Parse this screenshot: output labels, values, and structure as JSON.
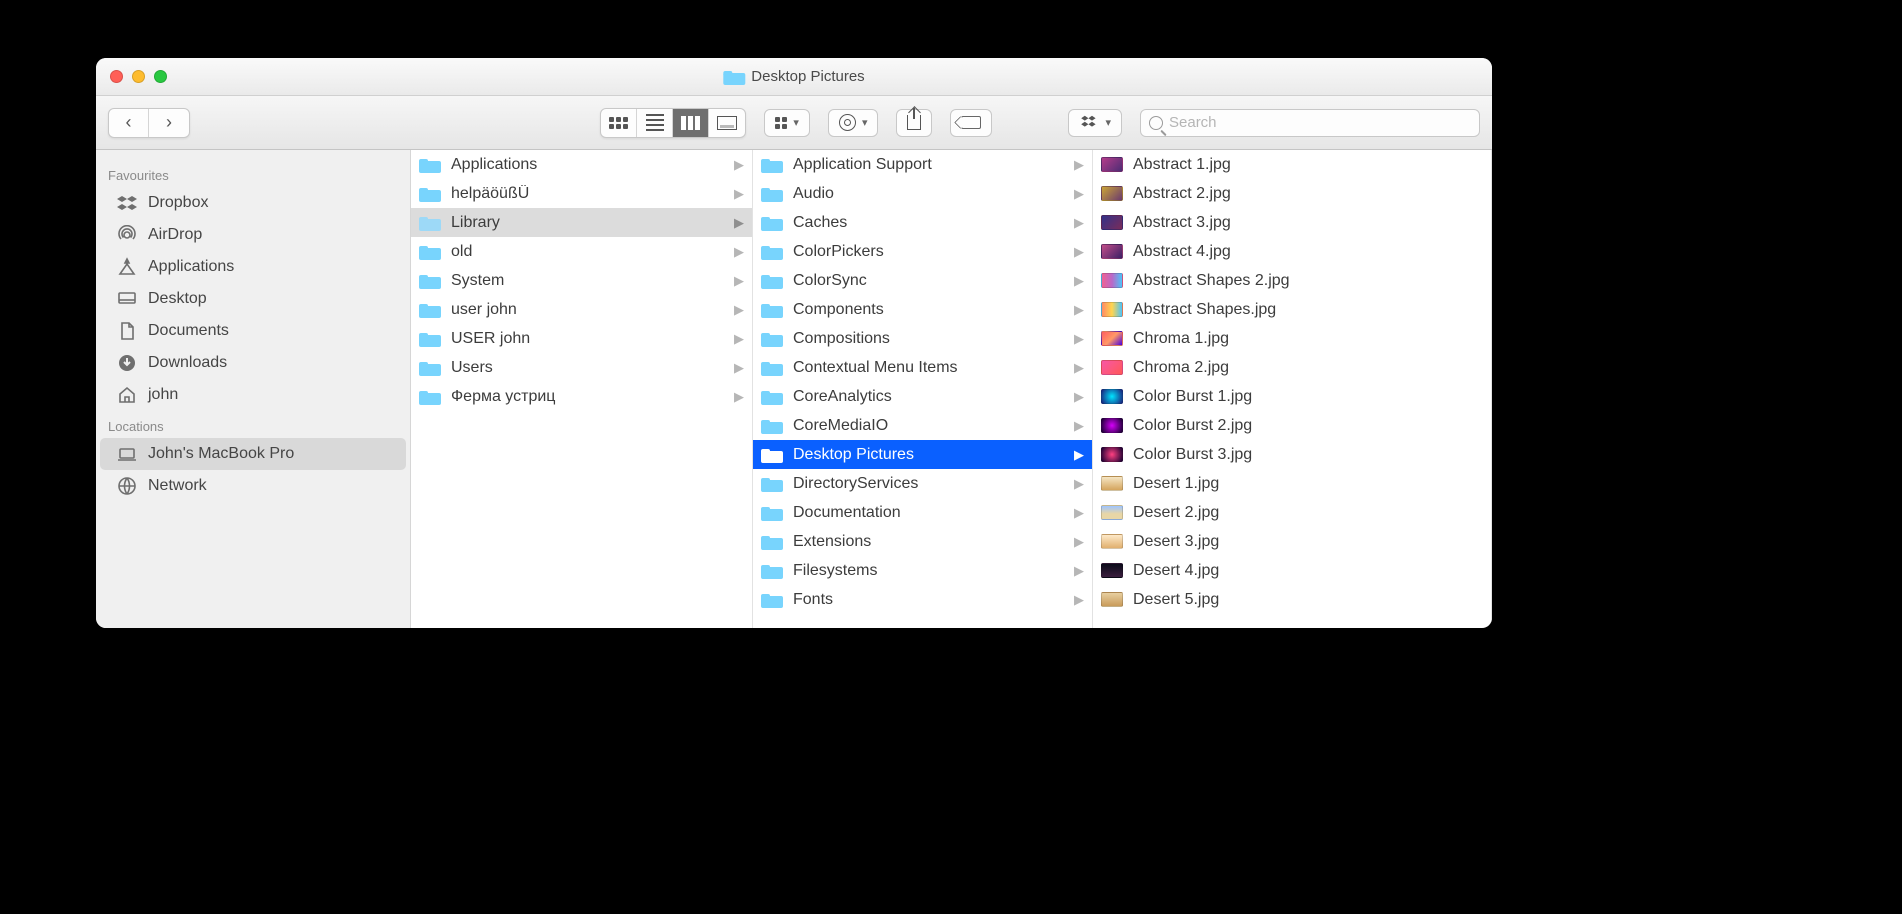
{
  "window": {
    "title": "Desktop Pictures"
  },
  "search": {
    "placeholder": "Search"
  },
  "sidebar": {
    "sections": [
      {
        "heading": "Favourites",
        "items": [
          {
            "icon": "dropbox",
            "label": "Dropbox"
          },
          {
            "icon": "airdrop",
            "label": "AirDrop"
          },
          {
            "icon": "apps",
            "label": "Applications"
          },
          {
            "icon": "desktop",
            "label": "Desktop"
          },
          {
            "icon": "documents",
            "label": "Documents"
          },
          {
            "icon": "downloads",
            "label": "Downloads"
          },
          {
            "icon": "home",
            "label": "john"
          }
        ]
      },
      {
        "heading": "Locations",
        "items": [
          {
            "icon": "laptop",
            "label": "John's MacBook Pro",
            "selected": true
          },
          {
            "icon": "network",
            "label": "Network"
          }
        ]
      }
    ]
  },
  "columns": [
    {
      "items": [
        {
          "label": "Applications",
          "type": "folder",
          "hasChildren": true
        },
        {
          "label": "helpäöüßÜ",
          "type": "folder",
          "hasChildren": true
        },
        {
          "label": "Library",
          "type": "folder",
          "hasChildren": true,
          "state": "path"
        },
        {
          "label": "old",
          "type": "folder",
          "hasChildren": true
        },
        {
          "label": "System",
          "type": "folder",
          "hasChildren": true
        },
        {
          "label": "user john",
          "type": "folder",
          "hasChildren": true
        },
        {
          "label": "USER john",
          "type": "folder",
          "hasChildren": true
        },
        {
          "label": "Users",
          "type": "folder",
          "hasChildren": true
        },
        {
          "label": "Ферма устриц",
          "type": "folder",
          "hasChildren": true
        }
      ]
    },
    {
      "items": [
        {
          "label": "Application Support",
          "type": "folder",
          "hasChildren": true
        },
        {
          "label": "Audio",
          "type": "folder",
          "hasChildren": true
        },
        {
          "label": "Caches",
          "type": "folder",
          "hasChildren": true
        },
        {
          "label": "ColorPickers",
          "type": "folder",
          "hasChildren": true
        },
        {
          "label": "ColorSync",
          "type": "folder",
          "hasChildren": true
        },
        {
          "label": "Components",
          "type": "folder",
          "hasChildren": true
        },
        {
          "label": "Compositions",
          "type": "folder",
          "hasChildren": true
        },
        {
          "label": "Contextual Menu Items",
          "type": "folder",
          "hasChildren": true
        },
        {
          "label": "CoreAnalytics",
          "type": "folder",
          "hasChildren": true
        },
        {
          "label": "CoreMediaIO",
          "type": "folder",
          "hasChildren": true
        },
        {
          "label": "Desktop Pictures",
          "type": "folder",
          "hasChildren": true,
          "state": "selected"
        },
        {
          "label": "DirectoryServices",
          "type": "folder",
          "hasChildren": true
        },
        {
          "label": "Documentation",
          "type": "folder",
          "hasChildren": true
        },
        {
          "label": "Extensions",
          "type": "folder",
          "hasChildren": true
        },
        {
          "label": "Filesystems",
          "type": "folder",
          "hasChildren": true
        },
        {
          "label": "Fonts",
          "type": "folder",
          "hasChildren": true
        }
      ]
    },
    {
      "items": [
        {
          "label": "Abstract 1.jpg",
          "type": "image",
          "thumb": "t1"
        },
        {
          "label": "Abstract 2.jpg",
          "type": "image",
          "thumb": "t2"
        },
        {
          "label": "Abstract 3.jpg",
          "type": "image",
          "thumb": "t3"
        },
        {
          "label": "Abstract 4.jpg",
          "type": "image",
          "thumb": "t4"
        },
        {
          "label": "Abstract Shapes 2.jpg",
          "type": "image",
          "thumb": "t5"
        },
        {
          "label": "Abstract Shapes.jpg",
          "type": "image",
          "thumb": "t6"
        },
        {
          "label": "Chroma 1.jpg",
          "type": "image",
          "thumb": "t7"
        },
        {
          "label": "Chroma 2.jpg",
          "type": "image",
          "thumb": "t8"
        },
        {
          "label": "Color Burst 1.jpg",
          "type": "image",
          "thumb": "t9"
        },
        {
          "label": "Color Burst 2.jpg",
          "type": "image",
          "thumb": "t10"
        },
        {
          "label": "Color Burst 3.jpg",
          "type": "image",
          "thumb": "t11"
        },
        {
          "label": "Desert 1.jpg",
          "type": "image",
          "thumb": "t12"
        },
        {
          "label": "Desert 2.jpg",
          "type": "image",
          "thumb": "t13"
        },
        {
          "label": "Desert 3.jpg",
          "type": "image",
          "thumb": "t14"
        },
        {
          "label": "Desert 4.jpg",
          "type": "image",
          "thumb": "t15"
        },
        {
          "label": "Desert 5.jpg",
          "type": "image",
          "thumb": "t16"
        }
      ]
    }
  ]
}
